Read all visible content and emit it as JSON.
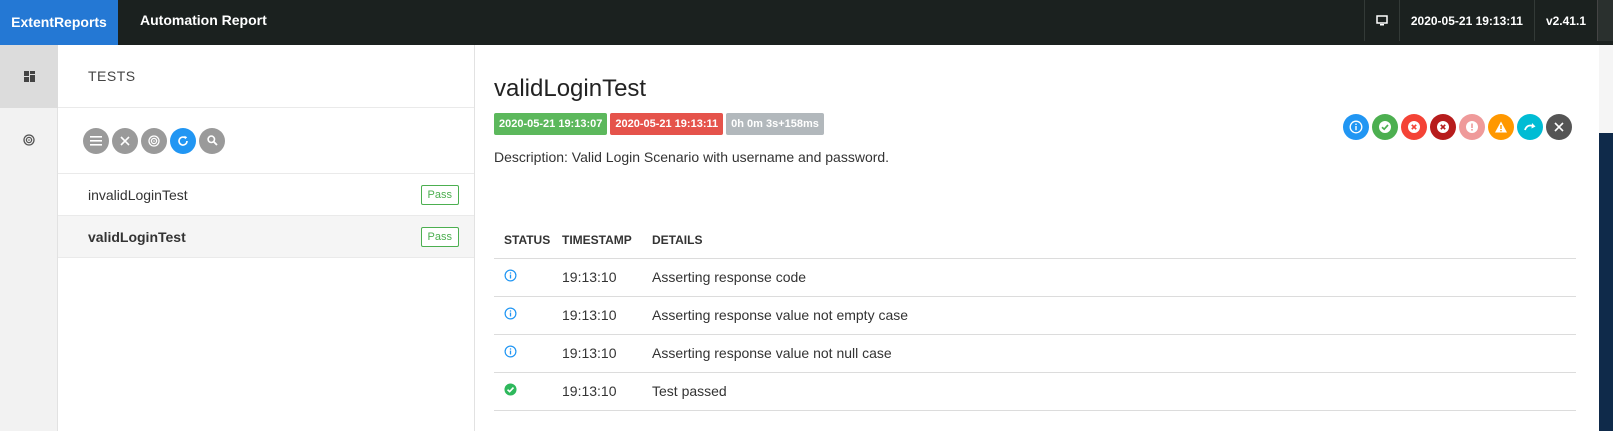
{
  "header": {
    "brand": "ExtentReports",
    "report_name": "Automation Report",
    "datetime": "2020-05-21 19:13:11",
    "version": "v2.41.1"
  },
  "test_panel": {
    "title": "TESTS",
    "tests": [
      {
        "name": "invalidLoginTest",
        "status": "Pass"
      },
      {
        "name": "validLoginTest",
        "status": "Pass"
      }
    ]
  },
  "test_detail": {
    "name": "validLoginTest",
    "start_time": "2020-05-21 19:13:07",
    "end_time": "2020-05-21 19:13:11",
    "duration": "0h 0m 3s+158ms",
    "description": "Description: Valid Login Scenario with username and password."
  },
  "log_table": {
    "headers": [
      "STATUS",
      "TIMESTAMP",
      "DETAILS"
    ],
    "rows": [
      {
        "status_icon": "info-icon",
        "timestamp": "19:13:10",
        "details": "Asserting response code"
      },
      {
        "status_icon": "info-icon",
        "timestamp": "19:13:10",
        "details": "Asserting response value not empty case"
      },
      {
        "status_icon": "info-icon",
        "timestamp": "19:13:10",
        "details": "Asserting response value not null case"
      },
      {
        "status_icon": "pass-icon",
        "timestamp": "19:13:10",
        "details": "Test passed"
      }
    ]
  },
  "colors": {
    "brand": "#2478d4",
    "topbar": "#1b211f",
    "pass": "#4caf50",
    "fail": "#e5534b",
    "info": "#2196f3"
  }
}
